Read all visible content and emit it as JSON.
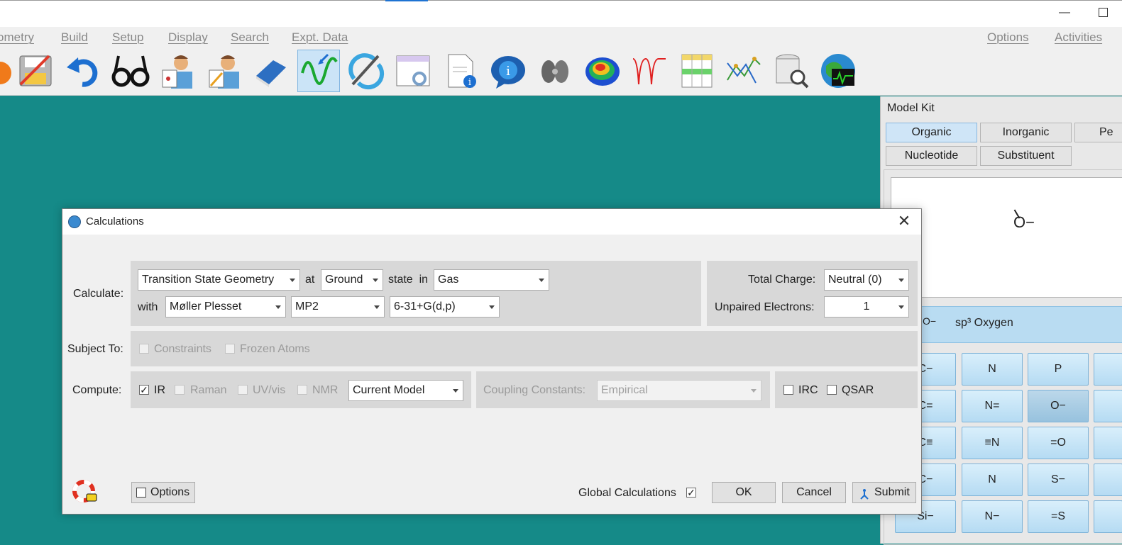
{
  "menu": {
    "geometry": "ometry",
    "build": "Build",
    "setup": "Setup",
    "display": "Display",
    "search": "Search",
    "expt_data": "Expt. Data",
    "options": "Options",
    "activities": "Activities"
  },
  "toolbar": {
    "icons": [
      "open-icon",
      "save-icon",
      "undo-icon",
      "glasses-icon",
      "scientist-view-icon",
      "scientist-edit-icon",
      "eraser-icon",
      "spectrum-icon",
      "refresh-icon",
      "settings-window-icon",
      "document-info-icon",
      "info-bubble-icon",
      "orbital-icon",
      "potential-map-icon",
      "ir-spectrum-icon",
      "spreadsheet-icon",
      "plot-icon",
      "database-search-icon",
      "globe-icon"
    ]
  },
  "model_kit": {
    "title": "Model Kit",
    "tabs": [
      "Organic",
      "Inorganic",
      "Pe",
      "Nucleotide",
      "Substituent"
    ],
    "preview": "O−",
    "selected_name": "sp³ Oxygen",
    "selected_prefix": "O−",
    "fragments": [
      "C−",
      "N",
      "P",
      "",
      "C=",
      "N=",
      "O−",
      "",
      "C≡",
      "≡N",
      "=O",
      "",
      "C−",
      "N",
      "S−",
      "",
      "Si−",
      "N−",
      "=S",
      ""
    ]
  },
  "dialog": {
    "title": "Calculations",
    "calculate_label": "Calculate:",
    "calc_type": "Transition State Geometry",
    "at_label": "at",
    "state": "Ground",
    "state_in_label": "state  in",
    "medium": "Gas",
    "with_label": "with",
    "method": "Møller Plesset",
    "level": "MP2",
    "basis": "6-31+G(d,p)",
    "total_charge_label": "Total Charge:",
    "total_charge": "Neutral (0)",
    "unpaired_label": "Unpaired Electrons:",
    "unpaired": "1",
    "subject_to_label": "Subject To:",
    "constraints": "Constraints",
    "frozen_atoms": "Frozen Atoms",
    "compute_label": "Compute:",
    "ir": "IR",
    "raman": "Raman",
    "uvvis": "UV/vis",
    "nmr": "NMR",
    "model": "Current Model",
    "coupling_label": "Coupling Constants:",
    "coupling": "Empirical",
    "irc": "IRC",
    "qsar": "QSAR",
    "options_btn": "Options",
    "global_calc": "Global Calculations",
    "ok": "OK",
    "cancel": "Cancel",
    "submit": "Submit",
    "check_mark": "✓",
    "close": "✕"
  }
}
